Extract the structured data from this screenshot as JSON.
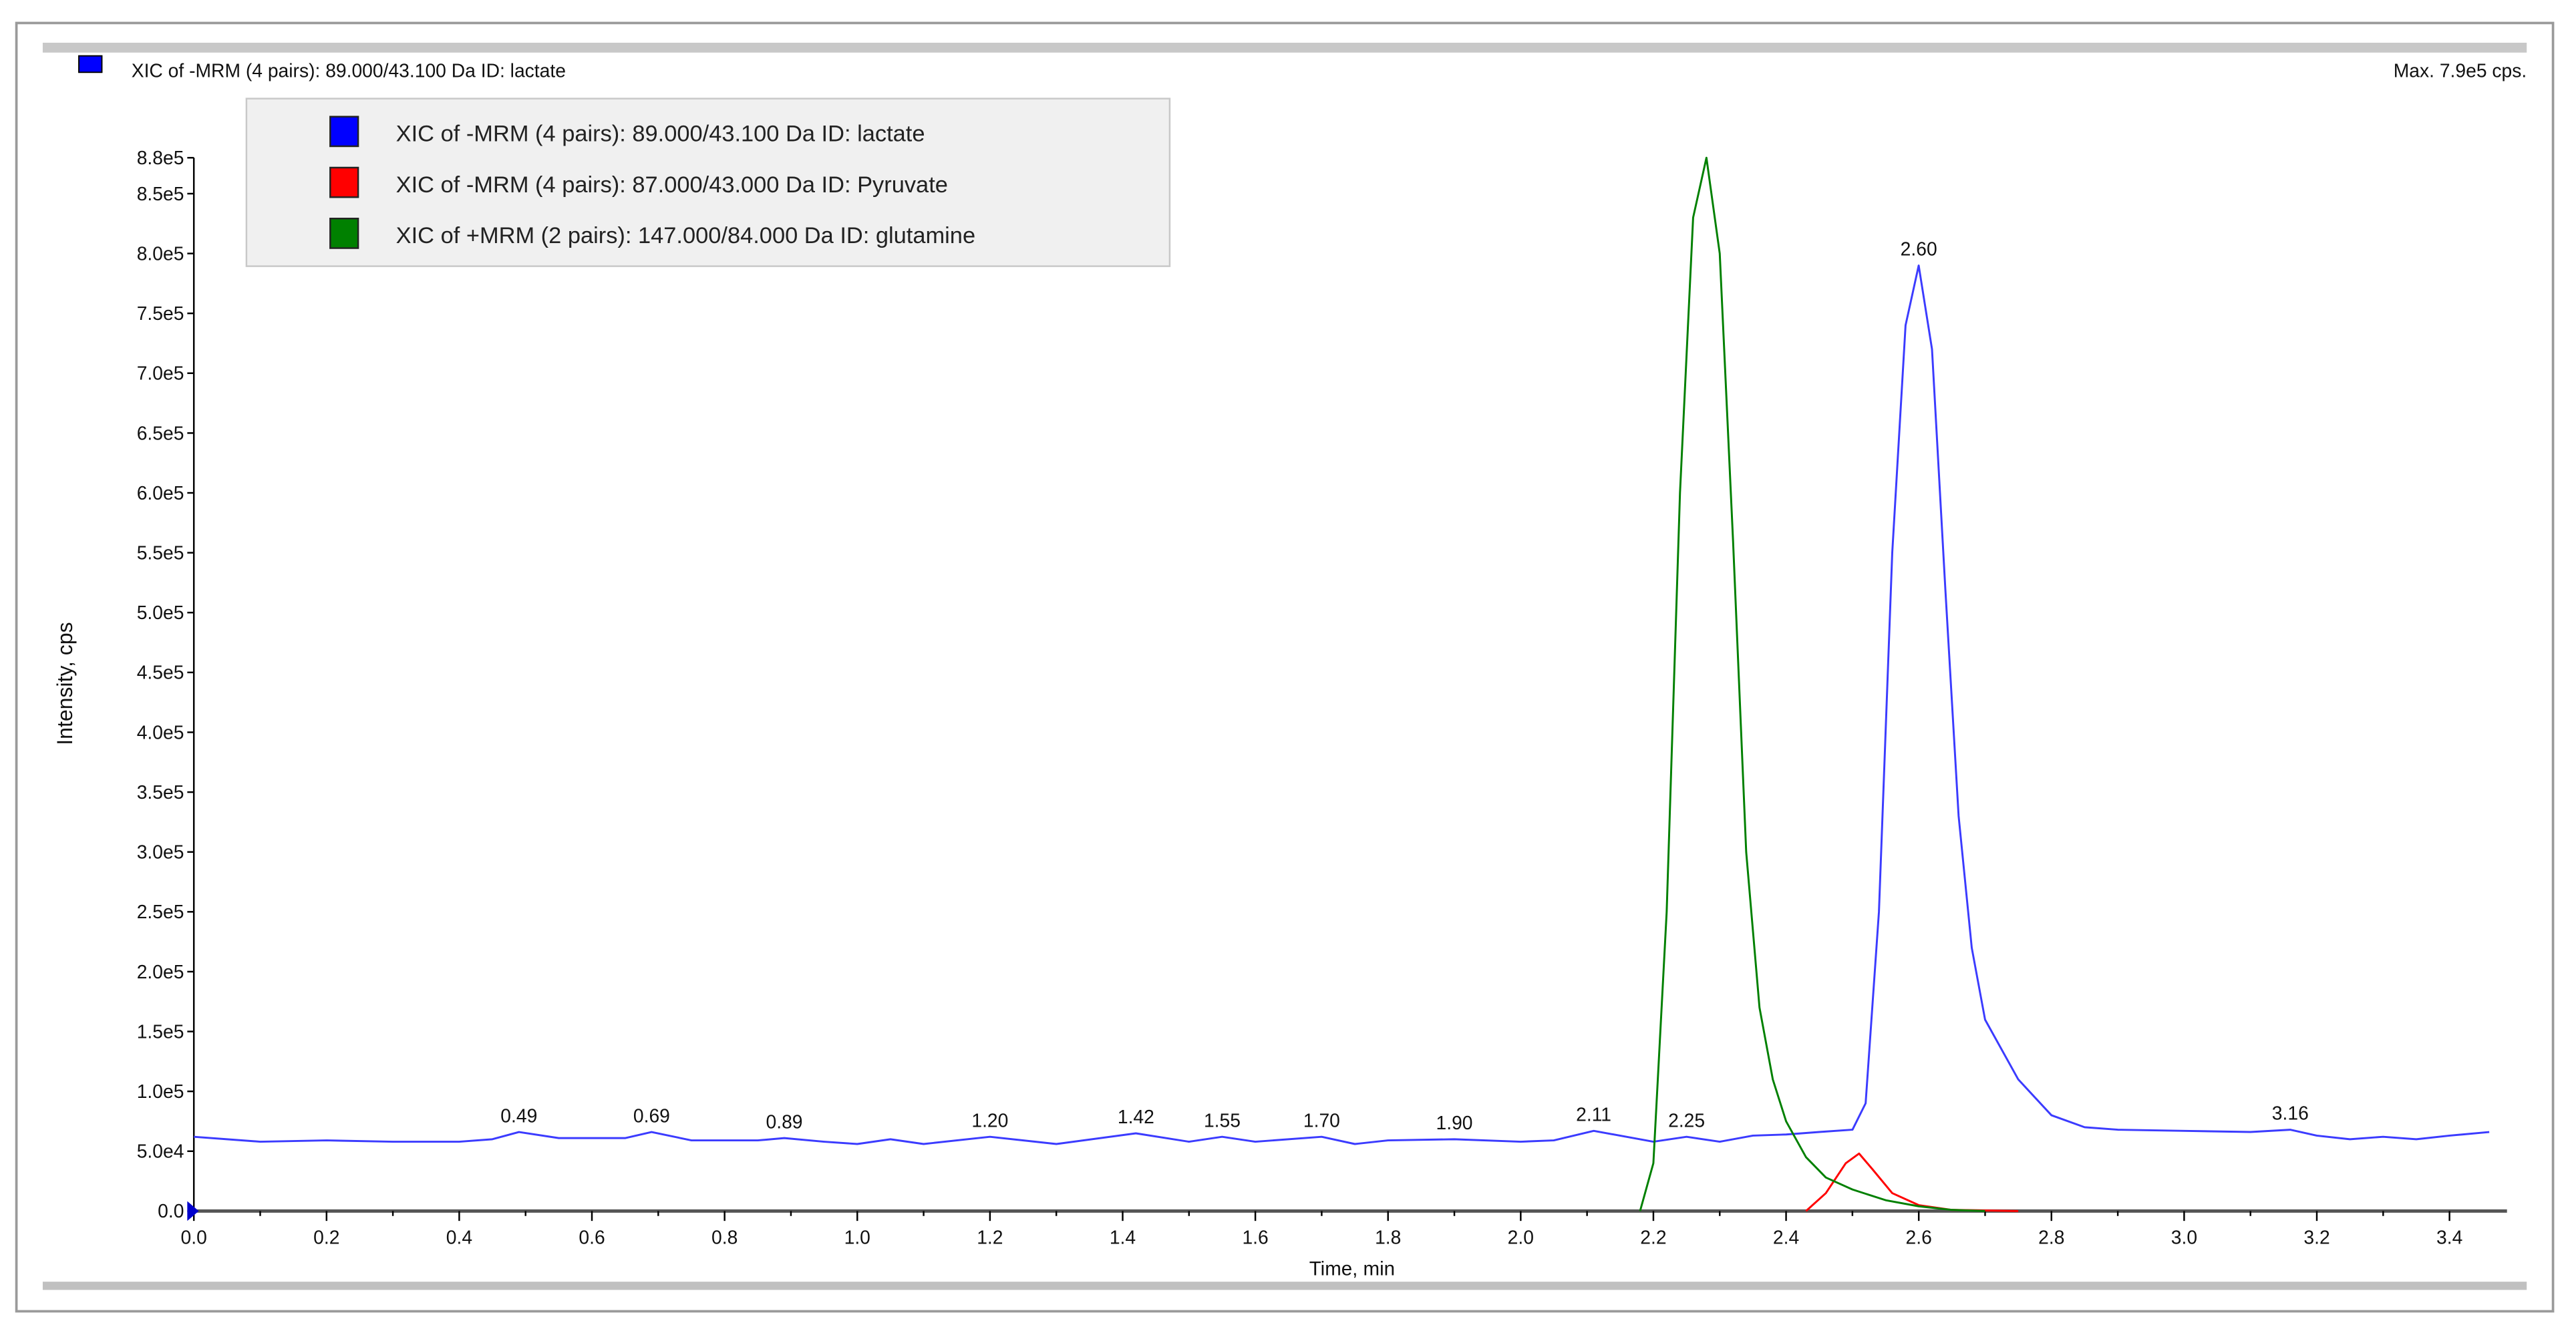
{
  "header": {
    "trace_title": "XIC of -MRM (4 pairs): 89.000/43.100 Da ID: lactate",
    "max_label": "Max. 7.9e5 cps."
  },
  "legend": [
    {
      "label": "XIC of -MRM (4 pairs): 89.000/43.100 Da ID: lactate",
      "color": "#0000ff"
    },
    {
      "label": "XIC of -MRM (4 pairs): 87.000/43.000 Da ID: Pyruvate",
      "color": "#ff0000"
    },
    {
      "label": "XIC of +MRM (2 pairs): 147.000/84.000 Da ID: glutamine",
      "color": "#008000"
    }
  ],
  "chart_data": {
    "type": "line",
    "title": "",
    "xlabel": "Time, min",
    "ylabel": "Intensity, cps",
    "xlim": [
      0,
      3.5
    ],
    "ylim": [
      0,
      880000
    ],
    "x_ticks": [
      "0.0",
      "0.2",
      "0.4",
      "0.6",
      "0.8",
      "1.0",
      "1.2",
      "1.4",
      "1.6",
      "1.8",
      "2.0",
      "2.2",
      "2.4",
      "2.6",
      "2.8",
      "3.0",
      "3.2",
      "3.4"
    ],
    "y_ticks": [
      {
        "v": 0,
        "label": "0.0"
      },
      {
        "v": 50000,
        "label": "5.0e4"
      },
      {
        "v": 100000,
        "label": "1.0e5"
      },
      {
        "v": 150000,
        "label": "1.5e5"
      },
      {
        "v": 200000,
        "label": "2.0e5"
      },
      {
        "v": 250000,
        "label": "2.5e5"
      },
      {
        "v": 300000,
        "label": "3.0e5"
      },
      {
        "v": 350000,
        "label": "3.5e5"
      },
      {
        "v": 400000,
        "label": "4.0e5"
      },
      {
        "v": 450000,
        "label": "4.5e5"
      },
      {
        "v": 500000,
        "label": "5.0e5"
      },
      {
        "v": 550000,
        "label": "5.5e5"
      },
      {
        "v": 600000,
        "label": "6.0e5"
      },
      {
        "v": 650000,
        "label": "6.5e5"
      },
      {
        "v": 700000,
        "label": "7.0e5"
      },
      {
        "v": 750000,
        "label": "7.5e5"
      },
      {
        "v": 800000,
        "label": "8.0e5"
      },
      {
        "v": 850000,
        "label": "8.5e5"
      },
      {
        "v": 880000,
        "label": "8.8e5"
      }
    ],
    "series": [
      {
        "name": "lactate",
        "color": "#3b3bff",
        "points": [
          [
            0,
            62000
          ],
          [
            0.05,
            60000
          ],
          [
            0.1,
            58000
          ],
          [
            0.2,
            59000
          ],
          [
            0.3,
            58000
          ],
          [
            0.4,
            58000
          ],
          [
            0.45,
            60000
          ],
          [
            0.49,
            66000
          ],
          [
            0.55,
            61000
          ],
          [
            0.65,
            61000
          ],
          [
            0.69,
            66000
          ],
          [
            0.75,
            59000
          ],
          [
            0.85,
            59000
          ],
          [
            0.89,
            61000
          ],
          [
            0.95,
            58000
          ],
          [
            1.0,
            56000
          ],
          [
            1.05,
            60000
          ],
          [
            1.1,
            56000
          ],
          [
            1.2,
            62000
          ],
          [
            1.3,
            56000
          ],
          [
            1.42,
            65000
          ],
          [
            1.5,
            58000
          ],
          [
            1.55,
            62000
          ],
          [
            1.6,
            58000
          ],
          [
            1.7,
            62000
          ],
          [
            1.75,
            56000
          ],
          [
            1.8,
            59000
          ],
          [
            1.9,
            60000
          ],
          [
            2.0,
            58000
          ],
          [
            2.05,
            59000
          ],
          [
            2.11,
            67000
          ],
          [
            2.2,
            58000
          ],
          [
            2.25,
            62000
          ],
          [
            2.3,
            58000
          ],
          [
            2.35,
            63000
          ],
          [
            2.4,
            64000
          ],
          [
            2.45,
            66000
          ],
          [
            2.5,
            68000
          ],
          [
            2.52,
            90000
          ],
          [
            2.54,
            250000
          ],
          [
            2.56,
            550000
          ],
          [
            2.58,
            740000
          ],
          [
            2.6,
            790000
          ],
          [
            2.62,
            720000
          ],
          [
            2.64,
            520000
          ],
          [
            2.66,
            330000
          ],
          [
            2.68,
            220000
          ],
          [
            2.7,
            160000
          ],
          [
            2.75,
            110000
          ],
          [
            2.8,
            80000
          ],
          [
            2.85,
            70000
          ],
          [
            2.9,
            68000
          ],
          [
            3.0,
            67000
          ],
          [
            3.1,
            66000
          ],
          [
            3.16,
            68000
          ],
          [
            3.2,
            63000
          ],
          [
            3.25,
            60000
          ],
          [
            3.3,
            62000
          ],
          [
            3.35,
            60000
          ],
          [
            3.4,
            63000
          ],
          [
            3.46,
            66000
          ]
        ]
      },
      {
        "name": "Pyruvate",
        "color": "#ff0000",
        "points": [
          [
            2.43,
            0
          ],
          [
            2.46,
            15000
          ],
          [
            2.49,
            40000
          ],
          [
            2.51,
            48000
          ],
          [
            2.53,
            35000
          ],
          [
            2.56,
            15000
          ],
          [
            2.6,
            5000
          ],
          [
            2.65,
            1000
          ],
          [
            2.75,
            0
          ]
        ]
      },
      {
        "name": "glutamine",
        "color": "#008000",
        "points": [
          [
            2.18,
            0
          ],
          [
            2.2,
            40000
          ],
          [
            2.22,
            250000
          ],
          [
            2.24,
            600000
          ],
          [
            2.26,
            830000
          ],
          [
            2.28,
            880000
          ],
          [
            2.3,
            800000
          ],
          [
            2.32,
            560000
          ],
          [
            2.34,
            300000
          ],
          [
            2.36,
            170000
          ],
          [
            2.38,
            110000
          ],
          [
            2.4,
            75000
          ],
          [
            2.43,
            45000
          ],
          [
            2.46,
            28000
          ],
          [
            2.5,
            18000
          ],
          [
            2.55,
            9000
          ],
          [
            2.6,
            4000
          ],
          [
            2.65,
            1000
          ],
          [
            2.7,
            0
          ]
        ]
      }
    ],
    "annotations": [
      {
        "x": 0.49,
        "y": 66000,
        "label": "0.49"
      },
      {
        "x": 0.69,
        "y": 66000,
        "label": "0.69"
      },
      {
        "x": 0.89,
        "y": 61000,
        "label": "0.89"
      },
      {
        "x": 1.2,
        "y": 62000,
        "label": "1.20"
      },
      {
        "x": 1.42,
        "y": 65000,
        "label": "1.42"
      },
      {
        "x": 1.55,
        "y": 62000,
        "label": "1.55"
      },
      {
        "x": 1.7,
        "y": 62000,
        "label": "1.70"
      },
      {
        "x": 1.9,
        "y": 60000,
        "label": "1.90"
      },
      {
        "x": 2.11,
        "y": 67000,
        "label": "2.11"
      },
      {
        "x": 2.25,
        "y": 62000,
        "label": "2.25"
      },
      {
        "x": 2.6,
        "y": 790000,
        "label": "2.60"
      },
      {
        "x": 3.16,
        "y": 68000,
        "label": "3.16"
      }
    ],
    "grid": false,
    "legend_position": "top-left"
  }
}
